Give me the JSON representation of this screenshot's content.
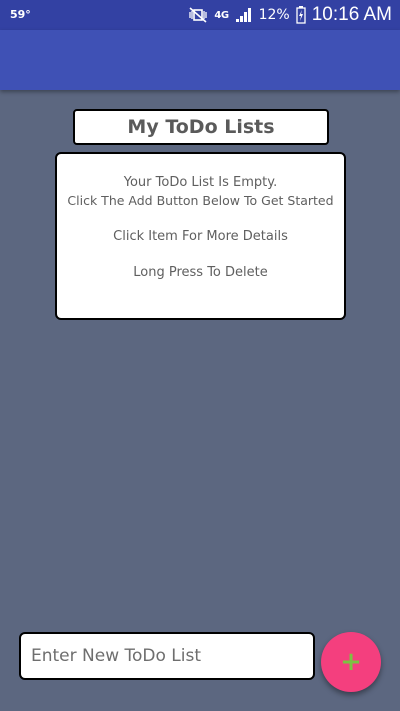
{
  "status_bar": {
    "left_text": "59°",
    "network": "4G",
    "battery_percent": "12%",
    "time": "10:16 AM",
    "icons": [
      "mute-vibrate-icon",
      "network-4g-icon",
      "signal-icon",
      "battery-icon"
    ]
  },
  "main": {
    "title": "My ToDo Lists",
    "empty_card": {
      "line1": "Your ToDo List Is Empty.",
      "line2": "Click The Add Button Below To Get Started",
      "line3": "Click Item For More Details",
      "line4": "Long Press To Delete"
    }
  },
  "footer": {
    "input_placeholder": "Enter New ToDo List",
    "add_button_label": "+"
  },
  "colors": {
    "app_bar": "#3f51b5",
    "status_bar": "#3341a3",
    "background": "#5c6780",
    "fab": "#f43f7e",
    "fab_icon": "#7cc242"
  }
}
